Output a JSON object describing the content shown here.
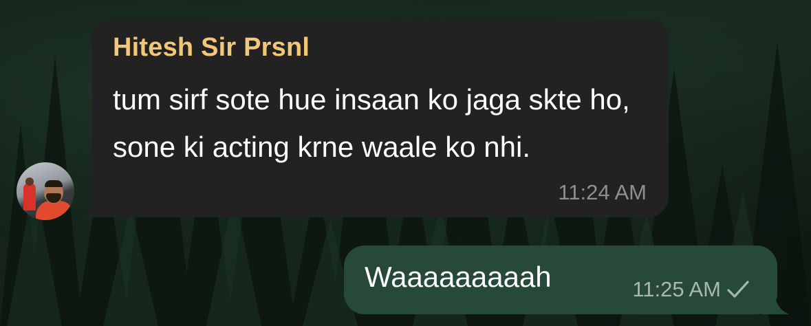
{
  "colors": {
    "incoming_bubble": "#222222",
    "outgoing_bubble": "#26493a",
    "sender_name": "#f2c778",
    "timestamp_in": "#8e8e93",
    "timestamp_out": "#a9b8ae",
    "text": "#ffffff"
  },
  "messages": [
    {
      "direction": "incoming",
      "sender": "Hitesh Sir Prsnl",
      "text": "tum sirf sote hue insaan ko jaga skte ho, sone ki acting krne waale ko nhi.",
      "time": "11:24 AM",
      "avatar_icon": "contact-avatar"
    },
    {
      "direction": "outgoing",
      "text": "Waaaaaaaaah",
      "time": "11:25 AM",
      "status_icon": "single-check-icon"
    }
  ]
}
